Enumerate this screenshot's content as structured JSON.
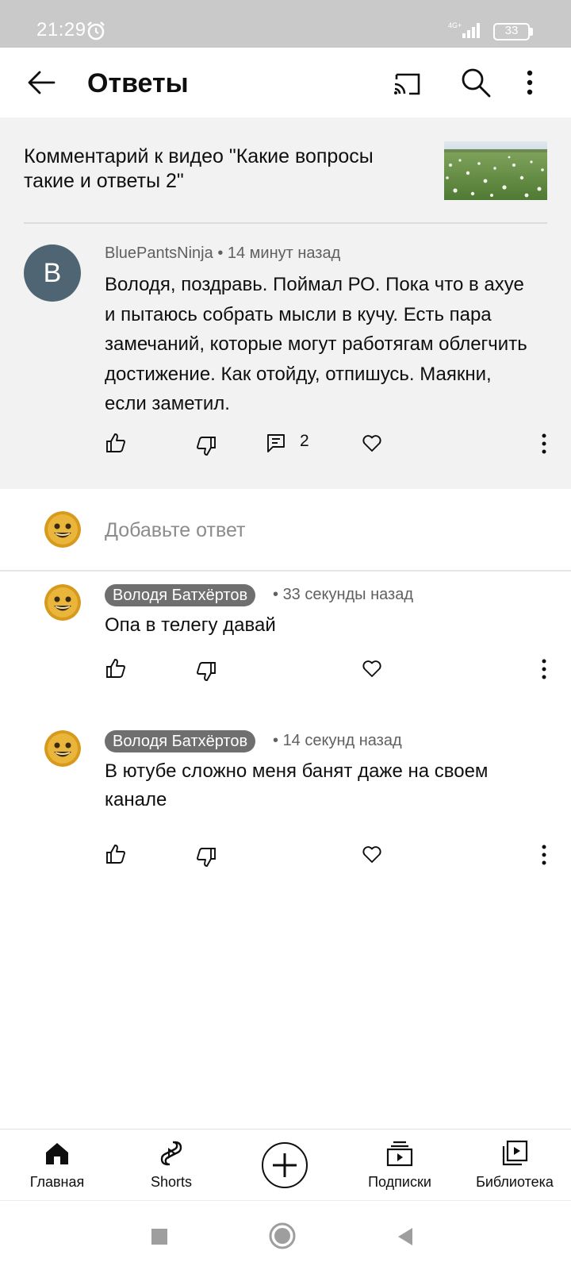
{
  "status_bar": {
    "time": "21:29",
    "network": "4G+",
    "battery": "33"
  },
  "app_bar": {
    "title": "Ответы"
  },
  "video": {
    "title": "Комментарий к видео \"Какие вопросы такие и ответы 2\""
  },
  "main_comment": {
    "avatar_letter": "B",
    "author": "BluePantsNinja",
    "time": "14 минут назад",
    "text": "Володя, поздравь. Поймал РО. Пока что в ахуе и пытаюсь собрать мысли в кучу. Есть пара замечаний, которые могут работягам облегчить достижение. Как отойду, отпишусь. Маякни, если заметил.",
    "reply_count": "2"
  },
  "add_reply": {
    "placeholder": "Добавьте ответ"
  },
  "replies": [
    {
      "author": "Володя Батхёртов",
      "time": "33 секунды назад",
      "text": "Опа в телегу давай"
    },
    {
      "author": "Володя Батхёртов",
      "time": "14 секунд назад",
      "text": "В ютубе сложно меня банят даже на своем канале"
    }
  ],
  "bottom_nav": {
    "home": "Главная",
    "shorts": "Shorts",
    "subscriptions": "Подписки",
    "library": "Библиотека"
  },
  "colors": {
    "status_bar": "#c9c9c9",
    "header_bg": "#f2f2f2",
    "avatar_bg": "#4f6573",
    "author_chip": "#6f6f6f"
  }
}
